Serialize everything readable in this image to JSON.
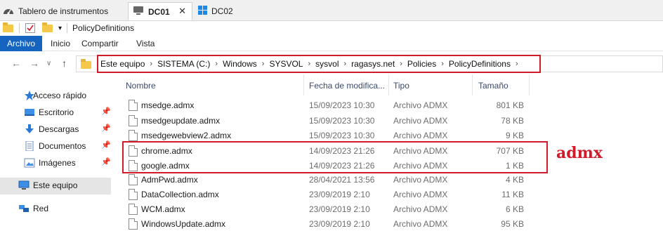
{
  "host_tabs": [
    {
      "label": "Tablero de instrumentos",
      "icon": "dashboard-icon"
    },
    {
      "label": "DC01",
      "icon": "computer-icon",
      "close": "✕"
    },
    {
      "label": "DC02",
      "icon": "windows-logo-icon"
    }
  ],
  "quick_access": {
    "title": "PolicyDefinitions"
  },
  "ribbon_tabs": [
    "Archivo",
    "Inicio",
    "Compartir",
    "Vista"
  ],
  "address": {
    "crumbs": [
      "Este equipo",
      "SISTEMA (C:)",
      "Windows",
      "SYSVOL",
      "sysvol",
      "ragasys.net",
      "Policies",
      "PolicyDefinitions"
    ]
  },
  "nav_pane": [
    {
      "label": "Acceso rápido",
      "icon": "star-icon"
    },
    {
      "label": "Escritorio",
      "icon": "desktop-icon",
      "pinned": true
    },
    {
      "label": "Descargas",
      "icon": "download-icon",
      "pinned": true
    },
    {
      "label": "Documentos",
      "icon": "documents-icon",
      "pinned": true
    },
    {
      "label": "Imágenes",
      "icon": "pictures-icon",
      "pinned": true
    },
    {
      "label": "Este equipo",
      "icon": "computer-icon",
      "selected": true
    },
    {
      "label": "Red",
      "icon": "network-icon"
    }
  ],
  "columns": {
    "name": "Nombre",
    "date": "Fecha de modifica...",
    "type": "Tipo",
    "size": "Tamaño"
  },
  "files": [
    {
      "name": "msedge.admx",
      "date": "15/09/2023 10:30",
      "type": "Archivo ADMX",
      "size": "801 KB"
    },
    {
      "name": "msedgeupdate.admx",
      "date": "15/09/2023 10:30",
      "type": "Archivo ADMX",
      "size": "78 KB"
    },
    {
      "name": "msedgewebview2.admx",
      "date": "15/09/2023 10:30",
      "type": "Archivo ADMX",
      "size": "9 KB"
    },
    {
      "name": "chrome.admx",
      "date": "14/09/2023 21:26",
      "type": "Archivo ADMX",
      "size": "707 KB"
    },
    {
      "name": "google.admx",
      "date": "14/09/2023 21:26",
      "type": "Archivo ADMX",
      "size": "1 KB"
    },
    {
      "name": "AdmPwd.admx",
      "date": "28/04/2021 13:56",
      "type": "Archivo ADMX",
      "size": "4 KB"
    },
    {
      "name": "DataCollection.admx",
      "date": "23/09/2019 2:10",
      "type": "Archivo ADMX",
      "size": "11 KB"
    },
    {
      "name": "WCM.admx",
      "date": "23/09/2019 2:10",
      "type": "Archivo ADMX",
      "size": "6 KB"
    },
    {
      "name": "WindowsUpdate.admx",
      "date": "23/09/2019 2:10",
      "type": "Archivo ADMX",
      "size": "95 KB"
    }
  ],
  "annotation": {
    "label": "admx",
    "color": "#d01b2a"
  },
  "colors": {
    "accent": "#1565c0",
    "highlight": "#d01b2a",
    "folder": "#f5c84a"
  }
}
